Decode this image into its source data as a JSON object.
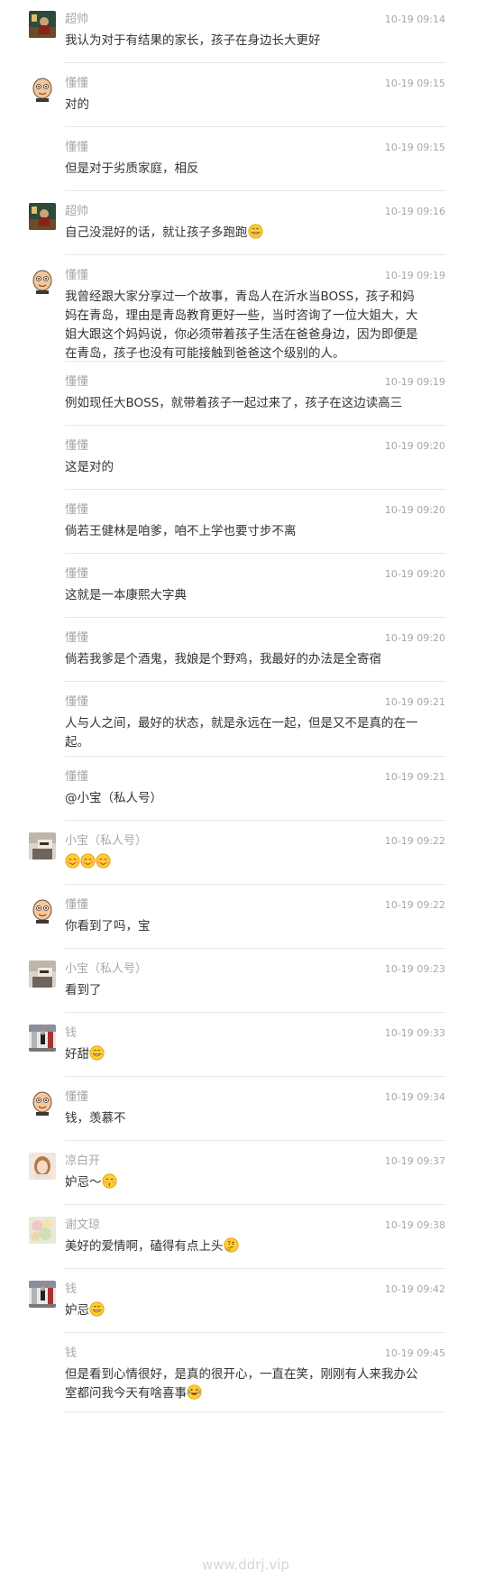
{
  "messages": [
    {
      "name": "超帅",
      "time": "10-19 09:14",
      "text": "我认为对于有结果的家长，孩子在身边长大更好",
      "avatar": "chaoshuai-photo"
    },
    {
      "name": "懂懂",
      "time": "10-19 09:15",
      "text": "对的",
      "avatar": "dongdong-cartoon"
    },
    {
      "name": "懂懂",
      "time": "10-19 09:15",
      "text": "但是对于劣质家庭，相反",
      "avatar": ""
    },
    {
      "name": "超帅",
      "time": "10-19 09:16",
      "text": "自己没混好的话，就让孩子多跑跑",
      "avatar": "chaoshuai-photo",
      "emoji": [
        "grin"
      ]
    },
    {
      "name": "懂懂",
      "time": "10-19 09:19",
      "text": "我曾经跟大家分享过一个故事，青岛人在沂水当BOSS，孩子和妈妈在青岛，理由是青岛教育更好一些，当时咨询了一位大姐大，大姐大跟这个妈妈说，你必须带着孩子生活在爸爸身边，因为即便是在青岛，孩子也没有可能接触到爸爸这个级别的人。",
      "avatar": "dongdong-cartoon"
    },
    {
      "name": "懂懂",
      "time": "10-19 09:19",
      "text": "例如现任大BOSS，就带着孩子一起过来了，孩子在这边读高三",
      "avatar": ""
    },
    {
      "name": "懂懂",
      "time": "10-19 09:20",
      "text": "这是对的",
      "avatar": ""
    },
    {
      "name": "懂懂",
      "time": "10-19 09:20",
      "text": "倘若王健林是咱爹，咱不上学也要寸步不离",
      "avatar": ""
    },
    {
      "name": "懂懂",
      "time": "10-19 09:20",
      "text": "这就是一本康熙大字典",
      "avatar": ""
    },
    {
      "name": "懂懂",
      "time": "10-19 09:20",
      "text": "倘若我爹是个酒鬼，我娘是个野鸡，我最好的办法是全寄宿",
      "avatar": ""
    },
    {
      "name": "懂懂",
      "time": "10-19 09:21",
      "text": "人与人之间，最好的状态，就是永远在一起，但是又不是真的在一起。",
      "avatar": ""
    },
    {
      "name": "懂懂",
      "time": "10-19 09:21",
      "text": "@小宝（私人号）",
      "avatar": ""
    },
    {
      "name": "小宝（私人号）",
      "time": "10-19 09:22",
      "text": "",
      "avatar": "xiaobao-photo",
      "emoji": [
        "blush",
        "blush",
        "blush"
      ]
    },
    {
      "name": "懂懂",
      "time": "10-19 09:22",
      "text": "你看到了吗，宝",
      "avatar": "dongdong-cartoon"
    },
    {
      "name": "小宝（私人号）",
      "time": "10-19 09:23",
      "text": "看到了",
      "avatar": "xiaobao-photo"
    },
    {
      "name": "钱",
      "time": "10-19 09:33",
      "text": "好甜",
      "avatar": "qian-photo",
      "emoji": [
        "grin"
      ]
    },
    {
      "name": "懂懂",
      "time": "10-19 09:34",
      "text": "钱，羡慕不",
      "avatar": "dongdong-cartoon"
    },
    {
      "name": "凉白开",
      "time": "10-19 09:37",
      "text": "妒忌～",
      "avatar": "liangbaikai-photo",
      "emoji": [
        "kiss"
      ]
    },
    {
      "name": "谢文琼",
      "time": "10-19 09:38",
      "text": "美好的爱情啊，磕得有点上头",
      "avatar": "xiewenqiong-photo",
      "emoji": [
        "think"
      ]
    },
    {
      "name": "钱",
      "time": "10-19 09:42",
      "text": "妒忌",
      "avatar": "qian-photo",
      "emoji": [
        "grin"
      ]
    },
    {
      "name": "钱",
      "time": "10-19 09:45",
      "text": "但是看到心情很好，是真的很开心，一直在笑，刚刚有人来我办公室都问我今天有啥喜事",
      "avatar": "",
      "emoji": [
        "laugh-tears"
      ]
    }
  ],
  "watermark": "www.ddrj.vip"
}
